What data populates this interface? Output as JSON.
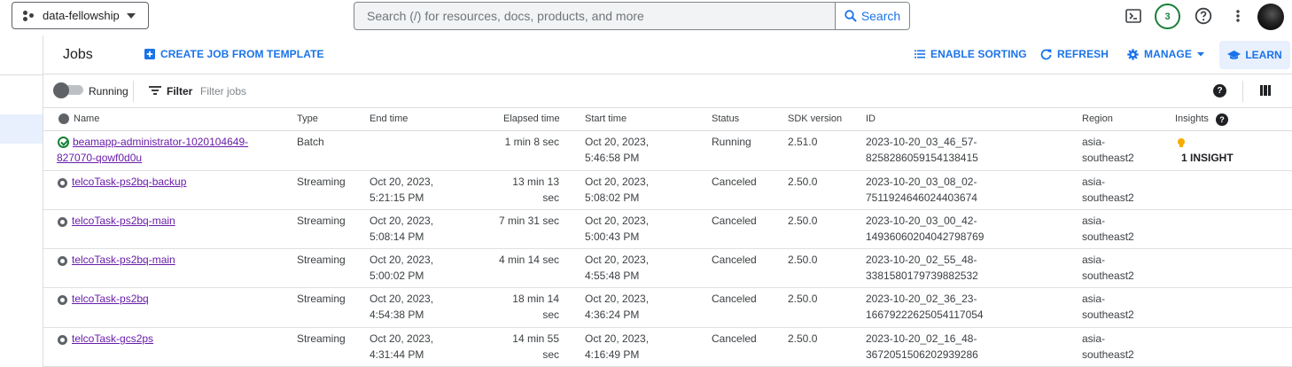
{
  "topbar": {
    "project": "data-fellowship",
    "search_placeholder": "Search (/) for resources, docs, products, and more",
    "search_button": "Search",
    "notifications_count": "3"
  },
  "header": {
    "title": "Jobs",
    "create_job": "CREATE JOB FROM TEMPLATE",
    "enable_sorting": "ENABLE SORTING",
    "refresh": "REFRESH",
    "manage": "MANAGE",
    "learn": "LEARN"
  },
  "toolbar": {
    "running_label": "Running",
    "filter_label": "Filter",
    "filter_placeholder": "Filter jobs"
  },
  "table": {
    "columns": {
      "name": "Name",
      "type": "Type",
      "end_time": "End time",
      "elapsed": "Elapsed time",
      "start_time": "Start time",
      "status": "Status",
      "sdk": "SDK version",
      "id": "ID",
      "region": "Region",
      "insights": "Insights"
    },
    "rows": [
      {
        "name_1": "beamapp-administrator-1020104649-",
        "name_2": "827070-qowf0d0u",
        "type": "Batch",
        "end_1": "",
        "end_2": "",
        "elapsed_1": "1 min 8 sec",
        "elapsed_2": "",
        "start_1": "Oct 20, 2023,",
        "start_2": "5:46:58 PM",
        "status": "Running",
        "sdk": "2.51.0",
        "id_1": "2023-10-20_03_46_57-",
        "id_2": "8258286059154138415",
        "region_1": "asia-",
        "region_2": "southeast2",
        "insight": "1 INSIGHT"
      },
      {
        "name_1": "telcoTask-ps2bq-backup",
        "name_2": "",
        "type": "Streaming",
        "end_1": "Oct 20, 2023,",
        "end_2": "5:21:15 PM",
        "elapsed_1": "13 min 13",
        "elapsed_2": "sec",
        "start_1": "Oct 20, 2023,",
        "start_2": "5:08:02 PM",
        "status": "Canceled",
        "sdk": "2.50.0",
        "id_1": "2023-10-20_03_08_02-",
        "id_2": "7511924646024403674",
        "region_1": "asia-",
        "region_2": "southeast2",
        "insight": ""
      },
      {
        "name_1": "telcoTask-ps2bq-main",
        "name_2": "",
        "type": "Streaming",
        "end_1": "Oct 20, 2023,",
        "end_2": "5:08:14 PM",
        "elapsed_1": "7 min 31 sec",
        "elapsed_2": "",
        "start_1": "Oct 20, 2023,",
        "start_2": "5:00:43 PM",
        "status": "Canceled",
        "sdk": "2.50.0",
        "id_1": "2023-10-20_03_00_42-",
        "id_2": "14936060204042798769",
        "region_1": "asia-",
        "region_2": "southeast2",
        "insight": ""
      },
      {
        "name_1": "telcoTask-ps2bq-main",
        "name_2": "",
        "type": "Streaming",
        "end_1": "Oct 20, 2023,",
        "end_2": "5:00:02 PM",
        "elapsed_1": "4 min 14 sec",
        "elapsed_2": "",
        "start_1": "Oct 20, 2023,",
        "start_2": "4:55:48 PM",
        "status": "Canceled",
        "sdk": "2.50.0",
        "id_1": "2023-10-20_02_55_48-",
        "id_2": "3381580179739882532",
        "region_1": "asia-",
        "region_2": "southeast2",
        "insight": ""
      },
      {
        "name_1": "telcoTask-ps2bq",
        "name_2": "",
        "type": "Streaming",
        "end_1": "Oct 20, 2023,",
        "end_2": "4:54:38 PM",
        "elapsed_1": "18 min 14",
        "elapsed_2": "sec",
        "start_1": "Oct 20, 2023,",
        "start_2": "4:36:24 PM",
        "status": "Canceled",
        "sdk": "2.50.0",
        "id_1": "2023-10-20_02_36_23-",
        "id_2": "16679222625054117054",
        "region_1": "asia-",
        "region_2": "southeast2",
        "insight": ""
      },
      {
        "name_1": "telcoTask-gcs2ps",
        "name_2": "",
        "type": "Streaming",
        "end_1": "Oct 20, 2023,",
        "end_2": "4:31:44 PM",
        "elapsed_1": "14 min 55",
        "elapsed_2": "sec",
        "start_1": "Oct 20, 2023,",
        "start_2": "4:16:49 PM",
        "status": "Canceled",
        "sdk": "2.50.0",
        "id_1": "2023-10-20_02_16_48-",
        "id_2": "3672051506202939286",
        "region_1": "asia-",
        "region_2": "southeast2",
        "insight": ""
      }
    ]
  }
}
